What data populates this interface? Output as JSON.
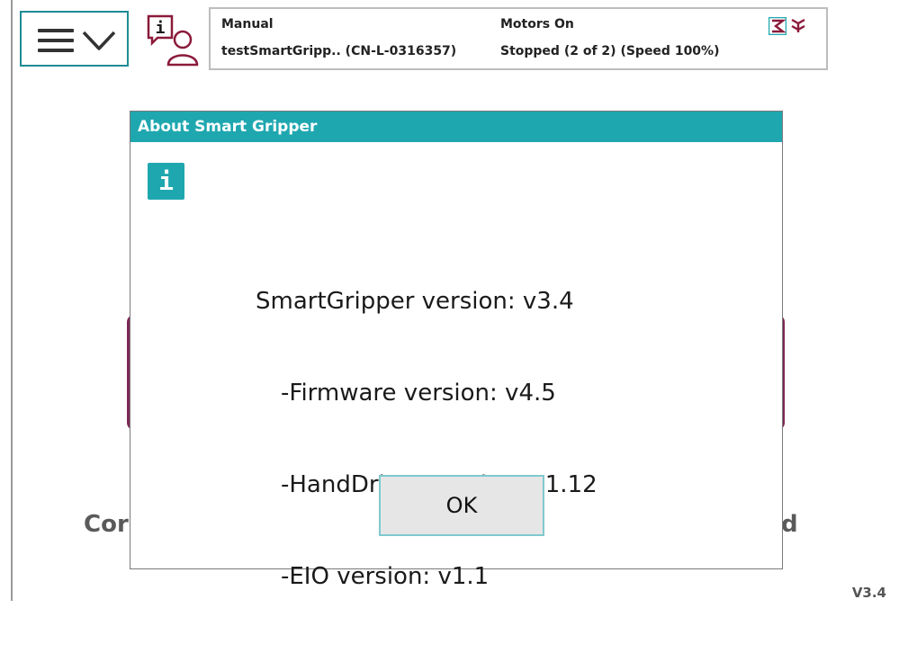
{
  "status": {
    "mode": "Manual",
    "task": "testSmartGripp.. (CN-L-0316357)",
    "motors": "Motors On",
    "state": "Stopped (2 of 2) (Speed 100%)"
  },
  "background": {
    "left_text_fragment": "Cor",
    "right_text_fragment": "d",
    "version": "V3.4"
  },
  "dialog": {
    "title": "About Smart Gripper",
    "info_glyph": "i",
    "lines": [
      "SmartGripper version: v3.4",
      "-Firmware version: v4.5",
      "-HandDriver version: v1.12",
      "-EIO version: v1.1"
    ],
    "ok_label": "OK"
  },
  "colors": {
    "accent": "#1fa7b0",
    "card_border": "#7c2855",
    "icon_red": "#8b1a3a"
  },
  "icons": [
    "menu-icon",
    "chevron-down-icon",
    "info-person-icon",
    "speed-icon",
    "speed-icon-2",
    "info-icon"
  ]
}
